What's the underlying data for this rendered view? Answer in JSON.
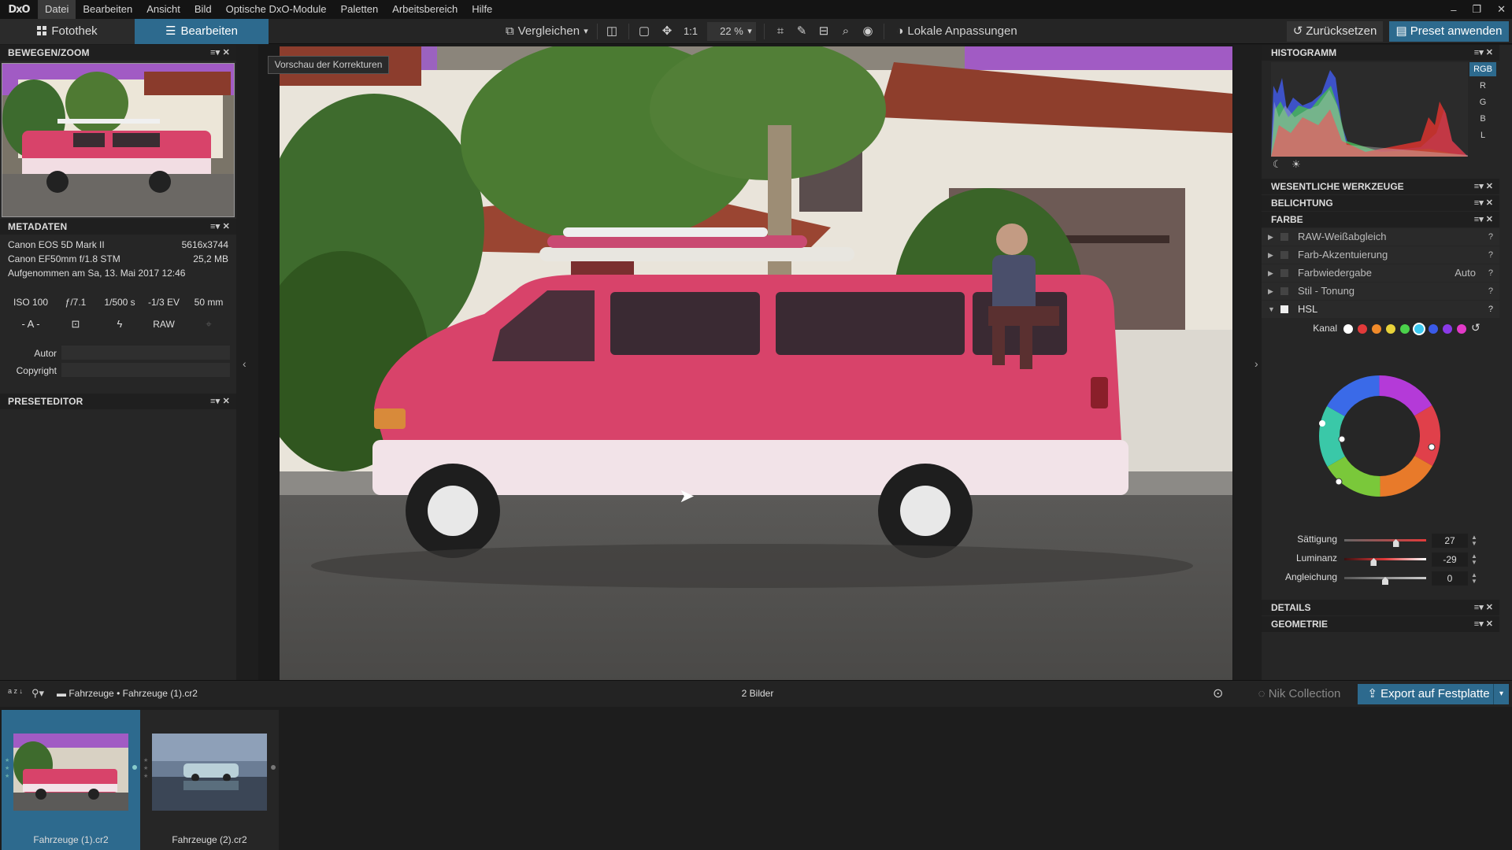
{
  "menu": {
    "logo": "DxO",
    "items": [
      "Datei",
      "Bearbeiten",
      "Ansicht",
      "Bild",
      "Optische DxO-Module",
      "Paletten",
      "Arbeitsbereich",
      "Hilfe"
    ],
    "window_controls": [
      "–",
      "❐",
      "✕"
    ]
  },
  "toolbar": {
    "tab_library": "Fotothek",
    "tab_edit": "Bearbeiten",
    "compare": "Vergleichen",
    "ratio": "1:1",
    "zoom": "22 %",
    "local_adjustments": "Lokale Anpassungen",
    "reset": "Zurücksetzen",
    "apply_preset": "Preset anwenden"
  },
  "left_panel": {
    "move_zoom_title": "BEWEGEN/ZOOM",
    "metadata_title": "METADATEN",
    "camera": "Canon EOS 5D Mark II",
    "dimensions": "5616x3744",
    "lens": "Canon EF50mm f/1.8 STM",
    "filesize": "25,2 MB",
    "taken": "Aufgenommen am Sa, 13. Mai 2017 12:46",
    "exif": {
      "iso": "ISO 100",
      "aperture": "ƒ/7.1",
      "shutter": "1/500 s",
      "ev": "-1/3 EV",
      "focal": "50 mm"
    },
    "mode": "- A -",
    "raw": "RAW",
    "author_label": "Autor",
    "copyright_label": "Copyright",
    "preset_editor_title": "PRESETEDITOR"
  },
  "viewer": {
    "preview_tooltip": "Vorschau der Korrekturen"
  },
  "right_panel": {
    "histogram_title": "HISTOGRAMM",
    "hist_channels": [
      "RGB",
      "R",
      "G",
      "B",
      "L"
    ],
    "essential_tools": "WESENTLICHE WERKZEUGE",
    "exposure": "BELICHTUNG",
    "color": "FARBE",
    "rows": [
      {
        "label": "RAW-Weißabgleich",
        "value": ""
      },
      {
        "label": "Farb-Akzentuierung",
        "value": ""
      },
      {
        "label": "Farbwiedergabe",
        "value": "Auto"
      },
      {
        "label": "Stil - Tonung",
        "value": ""
      }
    ],
    "hsl": "HSL",
    "channel_label": "Kanal",
    "sliders": [
      {
        "label": "Sättigung",
        "value": "27",
        "level": 0.63
      },
      {
        "label": "Luminanz",
        "value": "-29",
        "level": 0.36
      },
      {
        "label": "Angleichung",
        "value": "0",
        "level": 0.5
      }
    ],
    "details": "DETAILS",
    "geometry": "GEOMETRIE"
  },
  "bottom": {
    "sort": "a z",
    "path_folder": "Fahrzeuge",
    "path_file": "Fahrzeuge (1).cr2",
    "count": "2 Bilder",
    "nik": "Nik Collection",
    "export": "Export auf Festplatte",
    "films": [
      "Fahrzeuge (1).cr2",
      "Fahrzeuge (2).cr2"
    ]
  },
  "colors": {
    "accent": "#2d6a8e",
    "van": "#d8436a",
    "sky": "#a15bc4"
  }
}
